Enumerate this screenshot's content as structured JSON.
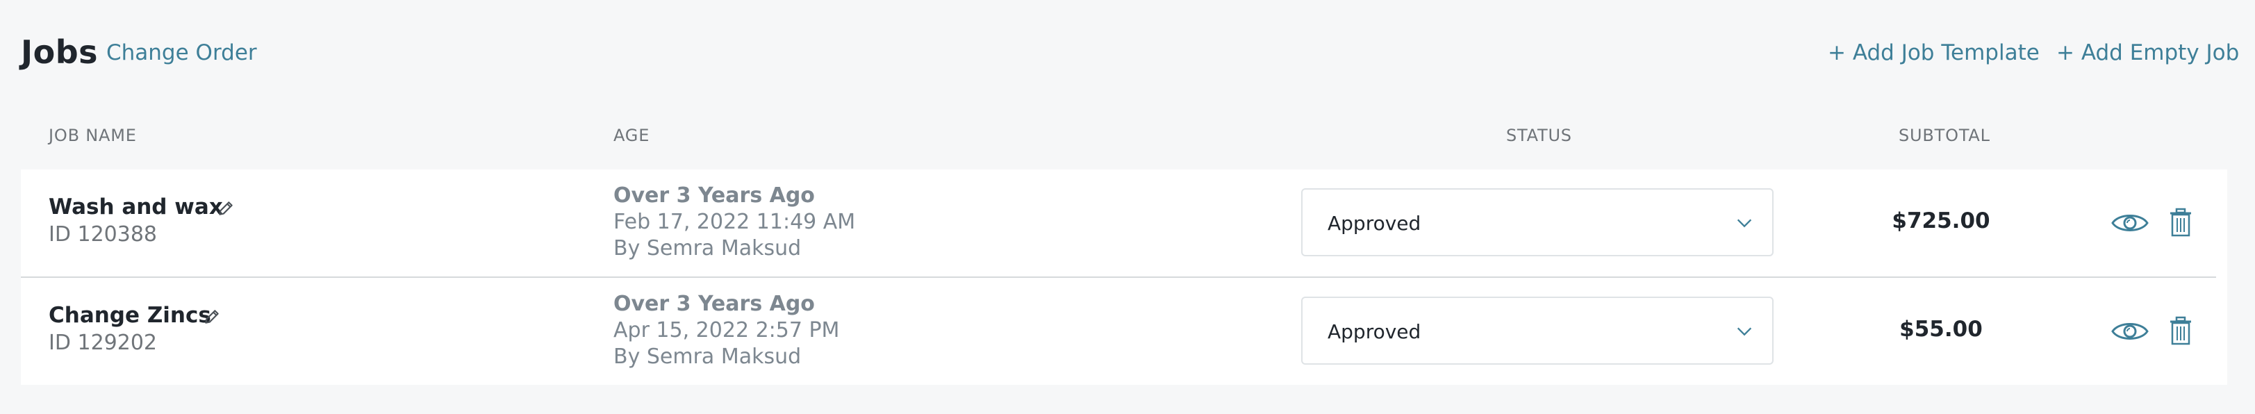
{
  "header": {
    "title": "Jobs",
    "change_order": "Change Order",
    "add_job_template": "+ Add Job Template",
    "add_empty_job": "+ Add Empty Job"
  },
  "columns": {
    "job_name": "JOB NAME",
    "age": "AGE",
    "status": "STATUS",
    "subtotal": "SUBTOTAL"
  },
  "rows": [
    {
      "name": "Wash and wax",
      "id": "ID 120388",
      "age_relative": "Over 3 Years Ago",
      "age_date": "Feb 17, 2022 11:49 AM",
      "age_by": "By Semra Maksud",
      "status": "Approved",
      "subtotal": "$725.00"
    },
    {
      "name": "Change Zincs",
      "id": "ID 129202",
      "age_relative": "Over 3 Years Ago",
      "age_date": "Apr 15, 2022 2:57 PM",
      "age_by": "By Semra Maksud",
      "status": "Approved",
      "subtotal": "$55.00"
    }
  ],
  "colors": {
    "accent": "#3e7f98",
    "background": "#f6f7f8",
    "muted_text": "#7d8790"
  }
}
